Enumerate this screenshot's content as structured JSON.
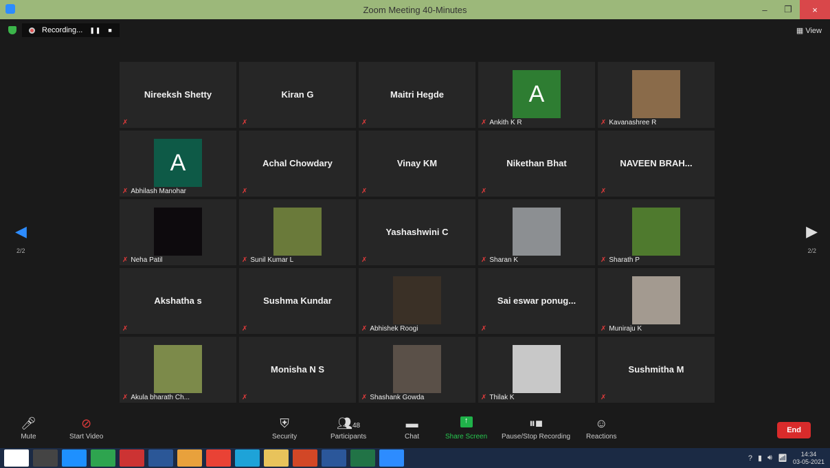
{
  "window": {
    "title": "Zoom Meeting 40-Minutes",
    "minimize": "–",
    "restore": "❐",
    "close": "×"
  },
  "recording": {
    "label": "Recording...",
    "pause": "❚❚",
    "stop": "■"
  },
  "view_label": "View",
  "pagination": {
    "left": "2/2",
    "right": "2/2"
  },
  "tiles": [
    {
      "name": "Nireeksh Shetty",
      "label": "",
      "kind": "name"
    },
    {
      "name": "Kiran G",
      "label": "",
      "kind": "name"
    },
    {
      "name": "Maitri Hegde",
      "label": "",
      "kind": "name"
    },
    {
      "name": "",
      "label": "Ankith K R",
      "kind": "letter",
      "letter": "A",
      "color": "#2e7d32"
    },
    {
      "name": "",
      "label": "Kavanashree R",
      "kind": "photo",
      "color": "#8a6b4a"
    },
    {
      "name": "",
      "label": "Abhilash Manohar",
      "kind": "letter",
      "letter": "A",
      "color": "#0e5a47"
    },
    {
      "name": "Achal Chowdary",
      "label": "",
      "kind": "name"
    },
    {
      "name": "Vinay KM",
      "label": "",
      "kind": "name"
    },
    {
      "name": "Nikethan Bhat",
      "label": "",
      "kind": "name"
    },
    {
      "name": "NAVEEN BRAH...",
      "label": "",
      "kind": "name"
    },
    {
      "name": "",
      "label": "Neha Patil",
      "kind": "photo",
      "color": "#0d0a0d"
    },
    {
      "name": "",
      "label": "Sunil Kumar L",
      "kind": "photo",
      "color": "#6a7a3a"
    },
    {
      "name": "Yashashwini C",
      "label": "",
      "kind": "name"
    },
    {
      "name": "",
      "label": "Sharan K",
      "kind": "photo",
      "color": "#8c8f92"
    },
    {
      "name": "",
      "label": "Sharath P",
      "kind": "photo",
      "color": "#4f7a2e"
    },
    {
      "name": "Akshatha s",
      "label": "",
      "kind": "name"
    },
    {
      "name": "Sushma Kundar",
      "label": "",
      "kind": "name"
    },
    {
      "name": "",
      "label": "Abhishek Roogi",
      "kind": "photo",
      "color": "#3a3026"
    },
    {
      "name": "Sai eswar ponug...",
      "label": "",
      "kind": "name"
    },
    {
      "name": "",
      "label": "Muniraju K",
      "kind": "photo",
      "color": "#a39a90"
    },
    {
      "name": "",
      "label": "Akula bharath Ch...",
      "kind": "photo",
      "color": "#7c8a4a"
    },
    {
      "name": "Monisha N S",
      "label": "",
      "kind": "name"
    },
    {
      "name": "",
      "label": "Shashank Gowda",
      "kind": "photo",
      "color": "#5a5048"
    },
    {
      "name": "",
      "label": "Thilak K",
      "kind": "photo",
      "color": "#c8c8c8"
    },
    {
      "name": "Sushmitha M",
      "label": "",
      "kind": "name"
    }
  ],
  "toolbar": {
    "mute": "Mute",
    "start_video": "Start Video",
    "security": "Security",
    "participants": "Participants",
    "participants_count": "48",
    "chat": "Chat",
    "share_screen": "Share Screen",
    "pause_stop_recording": "Pause/Stop Recording",
    "reactions": "Reactions",
    "end": "End"
  },
  "taskbar": {
    "apps": [
      "start",
      "obs",
      "ie",
      "store",
      "paint",
      "sway",
      "outlook",
      "chrome",
      "edge",
      "explorer",
      "powerpoint",
      "word",
      "excel",
      "zoom"
    ],
    "time": "14:34",
    "date": "03-05-2021"
  }
}
